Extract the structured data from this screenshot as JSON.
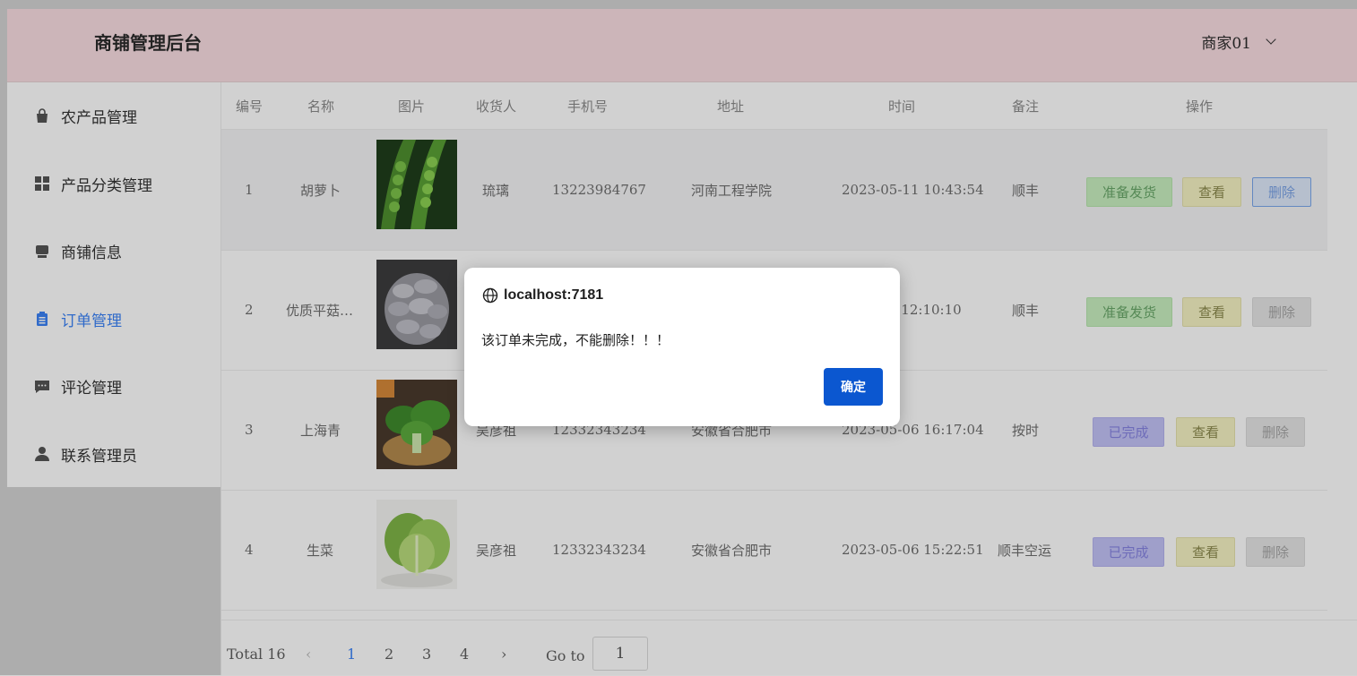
{
  "header": {
    "brand": "商铺管理后台",
    "user": "商家01"
  },
  "sidebar": {
    "items": [
      {
        "label": "农产品管理",
        "icon": "bag-icon"
      },
      {
        "label": "产品分类管理",
        "icon": "grid-icon"
      },
      {
        "label": "商铺信息",
        "icon": "store-icon"
      },
      {
        "label": "订单管理",
        "icon": "clipboard-icon",
        "active": true
      },
      {
        "label": "评论管理",
        "icon": "comment-icon"
      },
      {
        "label": "联系管理员",
        "icon": "user-icon"
      }
    ]
  },
  "table": {
    "headers": [
      "编号",
      "名称",
      "图片",
      "收货人",
      "手机号",
      "地址",
      "时间",
      "备注",
      "操作"
    ],
    "rows": [
      {
        "id": "1",
        "name": "胡萝卜",
        "image": "peas",
        "receiver": "琉璃",
        "phone": "13223984767",
        "address": "河南工程学院",
        "time": "2023-05-11 10:43:54",
        "note": "顺丰",
        "status_button": "准备发货",
        "view": "查看",
        "delete": "删除"
      },
      {
        "id": "2",
        "name": "优质平菇…",
        "image": "oyster-mushroom",
        "receiver": "",
        "phone": "",
        "address": "",
        "time": "7 12:10:10",
        "note": "顺丰",
        "status_button": "准备发货",
        "view": "查看",
        "delete": "删除"
      },
      {
        "id": "3",
        "name": "上海青",
        "image": "bok-choy",
        "receiver": "吴彦祖",
        "phone": "12332343234",
        "address": "安徽省合肥市",
        "time": "2023-05-06 16:17:04",
        "note": "按时",
        "status_button": "已完成",
        "view": "查看",
        "delete": "删除"
      },
      {
        "id": "4",
        "name": "生菜",
        "image": "lettuce",
        "receiver": "吴彦祖",
        "phone": "12332343234",
        "address": "安徽省合肥市",
        "time": "2023-05-06 15:22:51",
        "note": "顺丰空运",
        "status_button": "已完成",
        "view": "查看",
        "delete": "删除"
      }
    ]
  },
  "pagination": {
    "total": "Total 16",
    "pages": [
      "1",
      "2",
      "3",
      "4"
    ],
    "current": "1",
    "goto_label": "Go to",
    "goto_value": "1"
  },
  "dialog": {
    "title": "localhost:7181",
    "message": "该订单未完成，不能删除！！！",
    "ok": "确定"
  },
  "colors": {
    "header_bg": "#f9dde2",
    "active": "#3b82f6",
    "dialog_ok": "#0b57d0"
  }
}
